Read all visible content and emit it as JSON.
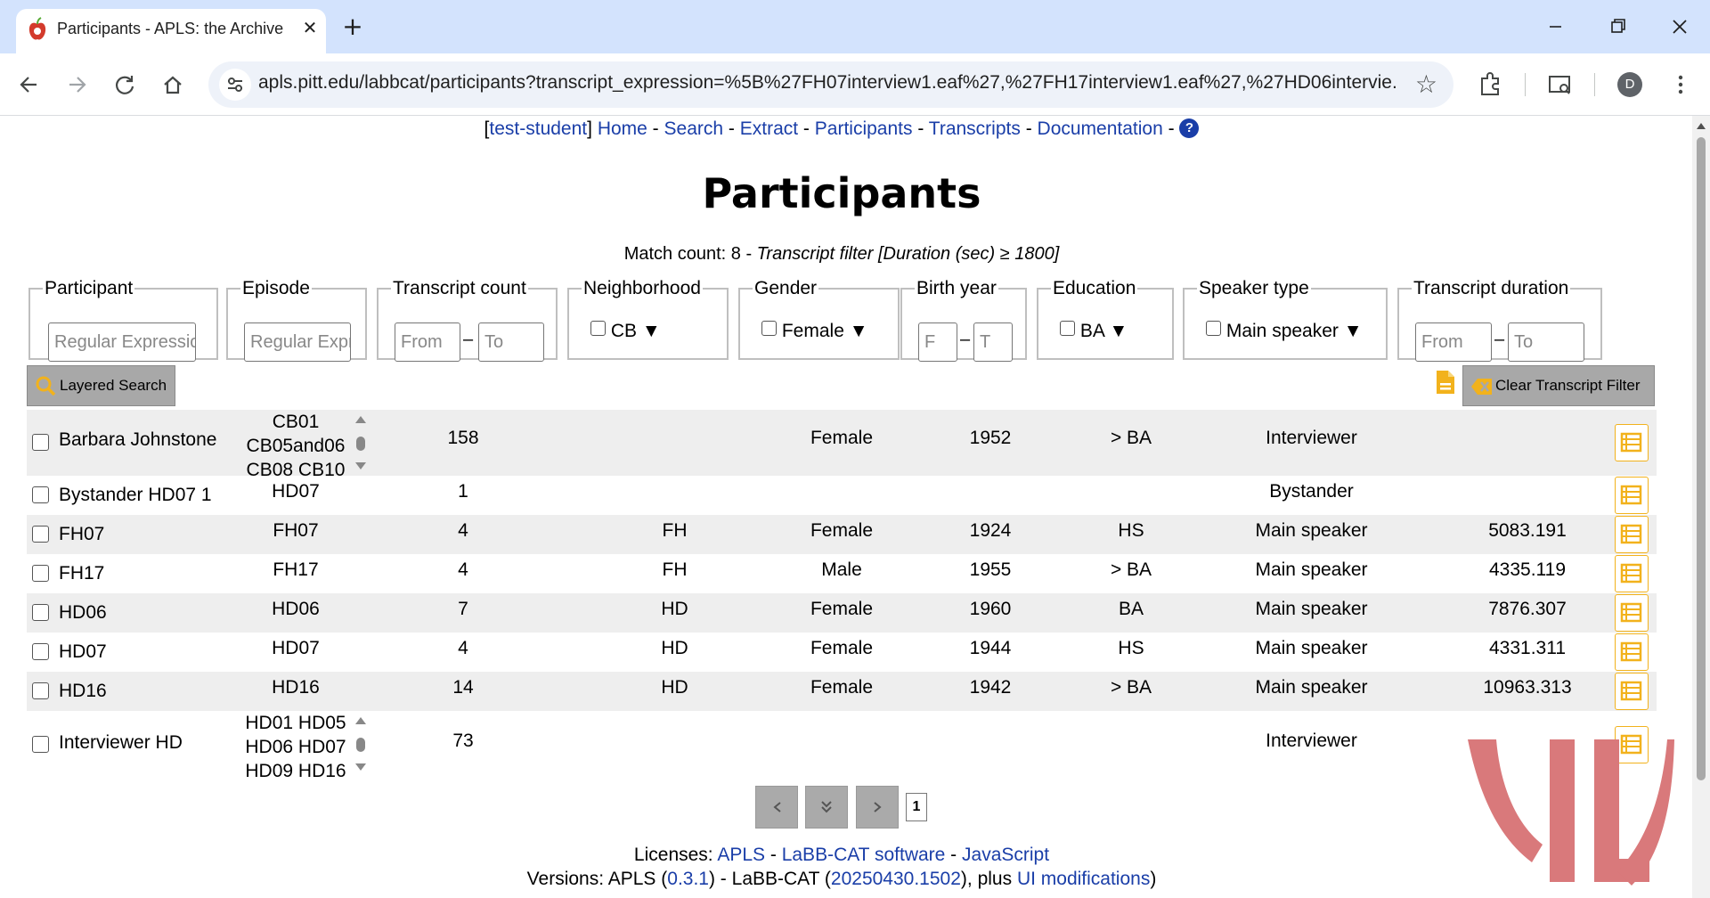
{
  "browser": {
    "tab_title": "Participants - APLS: the Archive",
    "url": "apls.pitt.edu/labbcat/participants?transcript_expression=%5B%27FH07interview1.eaf%27,%27FH17interview1.eaf%27,%27HD06intervie...",
    "profile_initial": "D"
  },
  "nav": {
    "user": "test-student",
    "links": [
      "Home",
      "Search",
      "Extract",
      "Participants",
      "Transcripts",
      "Documentation"
    ],
    "separator": " - "
  },
  "page": {
    "title": "Participants",
    "match_prefix": "Match count: 8 - ",
    "match_filter": "Transcript filter [Duration (sec) ≥ 1800]"
  },
  "filters": {
    "participant": {
      "legend": "Participant",
      "placeholder": "Regular Expression"
    },
    "episode": {
      "legend": "Episode",
      "placeholder": "Regular Expression"
    },
    "transcript_count": {
      "legend": "Transcript count",
      "from": "From",
      "to": "To"
    },
    "neighborhood": {
      "legend": "Neighborhood",
      "value": "CB"
    },
    "gender": {
      "legend": "Gender",
      "value": "Female"
    },
    "birth_year": {
      "legend": "Birth year",
      "from": "F",
      "to": "T"
    },
    "education": {
      "legend": "Education",
      "value": "BA"
    },
    "speaker_type": {
      "legend": "Speaker type",
      "value": "Main speaker"
    },
    "transcript_duration": {
      "legend": "Transcript duration",
      "from": "From",
      "to": "To"
    }
  },
  "buttons": {
    "layered_search": "Layered Search",
    "clear_filter": "Clear Transcript Filter"
  },
  "rows": [
    {
      "name": "Barbara Johnstone",
      "episodes": [
        "CB01",
        "CB05and06",
        "CB08 CB10"
      ],
      "count": "158",
      "neighborhood": "",
      "gender": "Female",
      "birth": "1952",
      "education": "> BA",
      "type": "Interviewer",
      "duration": ""
    },
    {
      "name": "Bystander HD07 1",
      "episodes": [
        "HD07"
      ],
      "count": "1",
      "neighborhood": "",
      "gender": "",
      "birth": "",
      "education": "",
      "type": "Bystander",
      "duration": ""
    },
    {
      "name": "FH07",
      "episodes": [
        "FH07"
      ],
      "count": "4",
      "neighborhood": "FH",
      "gender": "Female",
      "birth": "1924",
      "education": "HS",
      "type": "Main speaker",
      "duration": "5083.191"
    },
    {
      "name": "FH17",
      "episodes": [
        "FH17"
      ],
      "count": "4",
      "neighborhood": "FH",
      "gender": "Male",
      "birth": "1955",
      "education": "> BA",
      "type": "Main speaker",
      "duration": "4335.119"
    },
    {
      "name": "HD06",
      "episodes": [
        "HD06"
      ],
      "count": "7",
      "neighborhood": "HD",
      "gender": "Female",
      "birth": "1960",
      "education": "BA",
      "type": "Main speaker",
      "duration": "7876.307"
    },
    {
      "name": "HD07",
      "episodes": [
        "HD07"
      ],
      "count": "4",
      "neighborhood": "HD",
      "gender": "Female",
      "birth": "1944",
      "education": "HS",
      "type": "Main speaker",
      "duration": "4331.311"
    },
    {
      "name": "HD16",
      "episodes": [
        "HD16"
      ],
      "count": "14",
      "neighborhood": "HD",
      "gender": "Female",
      "birth": "1942",
      "education": "> BA",
      "type": "Main speaker",
      "duration": "10963.313"
    },
    {
      "name": "Interviewer HD",
      "episodes": [
        "HD01 HD05",
        "HD06 HD07",
        "HD09 HD16"
      ],
      "count": "73",
      "neighborhood": "",
      "gender": "",
      "birth": "",
      "education": "",
      "type": "Interviewer",
      "duration": ""
    }
  ],
  "pager": {
    "page": "1"
  },
  "footer": {
    "licenses_label": "Licenses: ",
    "license_links": [
      "APLS",
      "LaBB-CAT software",
      "JavaScript"
    ],
    "versions_label": "Versions: APLS (",
    "apls_version": "0.3.1",
    "labbcat_label": ") - LaBB-CAT (",
    "labbcat_version": "20250430.1502",
    "plus_label": ", plus ",
    "ui_mods": "UI modifications",
    "close_paren": ")"
  },
  "colors": {
    "link": "#1a3ea8",
    "accent_yellow": "#f2b21c",
    "row_shade": "#eeeeee",
    "watermark": "#d9797b"
  }
}
